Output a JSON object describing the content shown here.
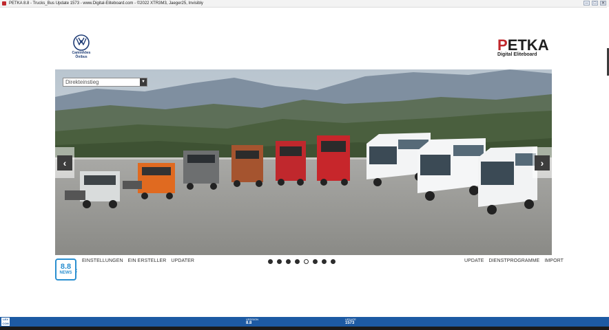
{
  "window": {
    "title": "PETKA 8.8 - Trucks_Bus Update 1573 -  www.Digital-Eliteboard.com - ©2022 XTR3M3, Jaeger25, Invisibly",
    "controls": {
      "minimize": "─",
      "maximize": "□",
      "close": "✕"
    }
  },
  "brand": {
    "vw_line1": "Caminhões",
    "vw_line2": "Ônibus",
    "petka_word_accent": "P",
    "petka_word_rest": "ETKA",
    "petka_sub": "Digital Eliteboard"
  },
  "hero": {
    "select_value": "Direkteinstieg",
    "prev_label": "‹",
    "next_label": "›"
  },
  "news": {
    "version": "8.8",
    "label": "NEWS"
  },
  "menu_left": [
    "EINSTELLUNGEN",
    "EIN ERSTELLER",
    "UPDATER"
  ],
  "menu_right": [
    "UPDATE",
    "DIENSTPROGRAMME",
    "IMPORT"
  ],
  "carousel": {
    "total": 8,
    "active_index": 4
  },
  "statusbar": {
    "logo": "LEX COM",
    "version_label": "VERSION",
    "version_value": "8.8",
    "update_label": "UPDATE",
    "update_value": "1573"
  },
  "colors": {
    "status_blue": "#1d5aa3",
    "news_blue": "#2a8fd0",
    "petka_red": "#c0282d"
  }
}
